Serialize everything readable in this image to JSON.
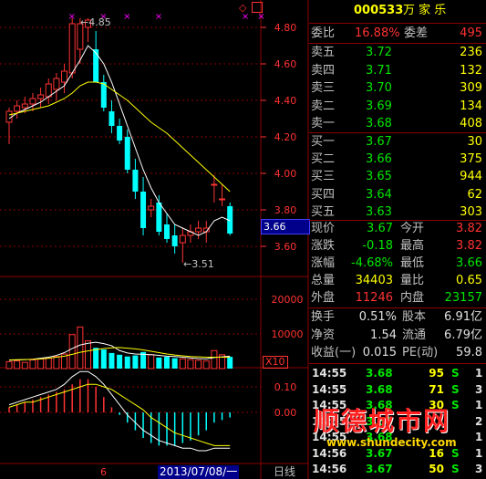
{
  "stock": {
    "code": "000533",
    "name": "万 家 乐"
  },
  "order_book": {
    "weibi_label": "委比",
    "weibi_value": "16.88%",
    "weicha_label": "委差",
    "weicha_value": "495",
    "asks": [
      {
        "label": "卖五",
        "price": "3.72",
        "vol": "236"
      },
      {
        "label": "卖四",
        "price": "3.71",
        "vol": "132"
      },
      {
        "label": "卖三",
        "price": "3.70",
        "vol": "309"
      },
      {
        "label": "卖二",
        "price": "3.69",
        "vol": "134"
      },
      {
        "label": "卖一",
        "price": "3.68",
        "vol": "408"
      }
    ],
    "bids": [
      {
        "label": "买一",
        "price": "3.67",
        "vol": "30"
      },
      {
        "label": "买二",
        "price": "3.66",
        "vol": "375"
      },
      {
        "label": "买三",
        "price": "3.65",
        "vol": "944"
      },
      {
        "label": "买四",
        "price": "3.64",
        "vol": "62"
      },
      {
        "label": "买五",
        "price": "3.63",
        "vol": "303"
      }
    ]
  },
  "quote": {
    "rows": [
      {
        "l1": "现价",
        "v1": "3.67",
        "c1": "gn",
        "l2": "今开",
        "v2": "3.82",
        "c2": "rd"
      },
      {
        "l1": "涨跌",
        "v1": "-0.18",
        "c1": "gn",
        "l2": "最高",
        "v2": "3.82",
        "c2": "rd"
      },
      {
        "l1": "涨幅",
        "v1": "-4.68%",
        "c1": "gn",
        "l2": "最低",
        "v2": "3.66",
        "c2": "gn"
      },
      {
        "l1": "总量",
        "v1": "34403",
        "c1": "yl",
        "l2": "量比",
        "v2": "0.65",
        "c2": "yl"
      },
      {
        "l1": "外盘",
        "v1": "11246",
        "c1": "rd",
        "l2": "内盘",
        "v2": "23157",
        "c2": "gn"
      }
    ],
    "rows2": [
      {
        "l1": "换手",
        "v1": "0.51%",
        "l2": "股本",
        "v2": "6.91亿"
      },
      {
        "l1": "净资",
        "v1": "1.54",
        "l2": "流通",
        "v2": "6.79亿"
      },
      {
        "l1": "收益(一)",
        "v1": "0.015",
        "l2": "PE(动)",
        "v2": "59.8"
      }
    ]
  },
  "ticks": [
    {
      "time": "14:55",
      "price": "3.68",
      "vol": "95",
      "side": "S",
      "n": "1"
    },
    {
      "time": "14:55",
      "price": "3.68",
      "vol": "71",
      "side": "S",
      "n": "3"
    },
    {
      "time": "14:55",
      "price": "3.68",
      "vol": "30",
      "side": "S",
      "n": "1"
    },
    {
      "time": "14:55",
      "price": "3.68",
      "vol": "",
      "side": "",
      "n": "2"
    },
    {
      "time": "14:55",
      "price": "3.68",
      "vol": "",
      "side": "",
      "n": "1"
    },
    {
      "time": "14:56",
      "price": "3.67",
      "vol": "16",
      "side": "S",
      "n": "1"
    },
    {
      "time": "14:56",
      "price": "3.67",
      "vol": "50",
      "side": "S",
      "n": "3"
    }
  ],
  "watermark": {
    "big": "顺德城市网",
    "small": "www.shundecity.com"
  },
  "chart_labels": {
    "price_marker": "3.66",
    "high_note": "4.85",
    "low_note": "3.51",
    "vol_unit": "X10",
    "x_date": "2013/07/08/一",
    "x_month": "6",
    "period": "日线"
  },
  "colors": {
    "up": "#ff3232",
    "down": "#00ffff",
    "bg": "#000000",
    "grid": "#8b0000",
    "ma5": "#ffffff",
    "ma10": "#ffff00"
  },
  "chart_data": [
    {
      "type": "candlestick",
      "title": "",
      "y_ticks": [
        4.8,
        4.6,
        4.4,
        4.2,
        4.0,
        3.8,
        3.6
      ],
      "ylim": [
        3.5,
        4.92
      ],
      "candles": [
        {
          "o": 4.28,
          "h": 4.36,
          "l": 4.16,
          "c": 4.34
        },
        {
          "o": 4.34,
          "h": 4.4,
          "l": 4.3,
          "c": 4.37
        },
        {
          "o": 4.36,
          "h": 4.42,
          "l": 4.33,
          "c": 4.38
        },
        {
          "o": 4.38,
          "h": 4.44,
          "l": 4.34,
          "c": 4.41
        },
        {
          "o": 4.41,
          "h": 4.47,
          "l": 4.36,
          "c": 4.43
        },
        {
          "o": 4.42,
          "h": 4.52,
          "l": 4.38,
          "c": 4.49
        },
        {
          "o": 4.46,
          "h": 4.55,
          "l": 4.4,
          "c": 4.52
        },
        {
          "o": 4.5,
          "h": 4.6,
          "l": 4.44,
          "c": 4.56
        },
        {
          "o": 4.55,
          "h": 4.85,
          "l": 4.52,
          "c": 4.82
        },
        {
          "o": 4.68,
          "h": 4.85,
          "l": 4.6,
          "c": 4.82
        },
        {
          "o": 4.8,
          "h": 4.85,
          "l": 4.72,
          "c": 4.84
        },
        {
          "o": 4.68,
          "h": 4.78,
          "l": 4.5,
          "c": 4.5
        },
        {
          "o": 4.5,
          "h": 4.54,
          "l": 4.34,
          "c": 4.36
        },
        {
          "o": 4.34,
          "h": 4.4,
          "l": 4.22,
          "c": 4.26
        },
        {
          "o": 4.26,
          "h": 4.3,
          "l": 4.16,
          "c": 4.18
        },
        {
          "o": 4.2,
          "h": 4.24,
          "l": 4.0,
          "c": 4.02
        },
        {
          "o": 4.02,
          "h": 4.08,
          "l": 3.86,
          "c": 3.9
        },
        {
          "o": 3.9,
          "h": 3.98,
          "l": 3.66,
          "c": 3.7
        },
        {
          "o": 3.8,
          "h": 3.86,
          "l": 3.76,
          "c": 3.82
        },
        {
          "o": 3.84,
          "h": 3.88,
          "l": 3.66,
          "c": 3.68
        },
        {
          "o": 3.72,
          "h": 3.78,
          "l": 3.62,
          "c": 3.64
        },
        {
          "o": 3.66,
          "h": 3.72,
          "l": 3.56,
          "c": 3.6
        },
        {
          "o": 3.62,
          "h": 3.7,
          "l": 3.51,
          "c": 3.66
        },
        {
          "o": 3.66,
          "h": 3.72,
          "l": 3.62,
          "c": 3.68
        },
        {
          "o": 3.68,
          "h": 3.74,
          "l": 3.64,
          "c": 3.7
        },
        {
          "o": 3.68,
          "h": 3.74,
          "l": 3.62,
          "c": 3.7
        },
        {
          "o": 3.94,
          "h": 3.99,
          "l": 3.84,
          "c": 3.94
        },
        {
          "o": 3.86,
          "h": 3.94,
          "l": 3.82,
          "c": 3.86
        },
        {
          "o": 3.82,
          "h": 3.84,
          "l": 3.66,
          "c": 3.67
        }
      ],
      "ma5": [
        4.3,
        4.33,
        4.35,
        4.37,
        4.39,
        4.42,
        4.45,
        4.48,
        4.55,
        4.62,
        4.7,
        4.66,
        4.6,
        4.5,
        4.38,
        4.26,
        4.14,
        4.02,
        3.92,
        3.84,
        3.78,
        3.72,
        3.7,
        3.68,
        3.66,
        3.68,
        3.74,
        3.76,
        3.74
      ],
      "ma10": [
        4.32,
        4.33,
        4.34,
        4.35,
        4.36,
        4.37,
        4.39,
        4.41,
        4.44,
        4.48,
        4.5,
        4.5,
        4.49,
        4.46,
        4.43,
        4.4,
        4.36,
        4.32,
        4.28,
        4.25,
        4.22,
        4.18,
        4.14,
        4.1,
        4.06,
        4.02,
        3.98,
        3.94,
        3.9
      ]
    },
    {
      "type": "bar",
      "title": "",
      "y_ticks": [
        20000,
        10000
      ],
      "unit": "X10",
      "values": [
        2000,
        2200,
        1800,
        2500,
        2800,
        3000,
        3500,
        4200,
        9800,
        12000,
        8000,
        6000,
        5500,
        4500,
        4000,
        3500,
        3800,
        4800,
        4000,
        3200,
        3400,
        3000,
        2800,
        2600,
        2400,
        2200,
        5200,
        4000,
        3400
      ],
      "ma5": [
        2400,
        2500,
        2600,
        2700,
        3000,
        3300,
        3800,
        4600,
        5800,
        6800,
        7300,
        7600,
        7200,
        6600,
        5200,
        4500,
        4200,
        4100,
        4000,
        3800,
        3600,
        3500,
        3300,
        3100,
        2900,
        2800,
        3200,
        3400,
        3600
      ],
      "ma10": [
        2500,
        2550,
        2600,
        2650,
        2800,
        3000,
        3300,
        3600,
        4100,
        4700,
        5100,
        5500,
        5800,
        6000,
        6100,
        5900,
        5700,
        5400,
        5000,
        4600,
        4200,
        3900,
        3700,
        3500,
        3400,
        3300,
        3300,
        3300,
        3300
      ]
    },
    {
      "type": "bar",
      "title": "",
      "y_ticks": [
        0.1,
        0.0
      ],
      "macd": [
        0.02,
        0.03,
        0.04,
        0.05,
        0.06,
        0.07,
        0.08,
        0.09,
        0.11,
        0.13,
        0.13,
        0.1,
        0.06,
        0.02,
        -0.01,
        -0.04,
        -0.07,
        -0.1,
        -0.12,
        -0.13,
        -0.13,
        -0.13,
        -0.12,
        -0.11,
        -0.09,
        -0.07,
        -0.04,
        -0.03,
        -0.02
      ],
      "dif": [
        0.03,
        0.04,
        0.05,
        0.06,
        0.07,
        0.08,
        0.09,
        0.11,
        0.14,
        0.16,
        0.16,
        0.14,
        0.11,
        0.07,
        0.03,
        -0.01,
        -0.04,
        -0.07,
        -0.09,
        -0.11,
        -0.12,
        -0.13,
        -0.14,
        -0.14,
        -0.15,
        -0.15,
        -0.14,
        -0.14,
        -0.14
      ],
      "dea": [
        0.02,
        0.03,
        0.04,
        0.04,
        0.05,
        0.06,
        0.07,
        0.08,
        0.09,
        0.1,
        0.11,
        0.11,
        0.1,
        0.09,
        0.07,
        0.05,
        0.03,
        0.01,
        -0.02,
        -0.04,
        -0.06,
        -0.08,
        -0.09,
        -0.1,
        -0.11,
        -0.12,
        -0.13,
        -0.13,
        -0.13
      ]
    }
  ]
}
